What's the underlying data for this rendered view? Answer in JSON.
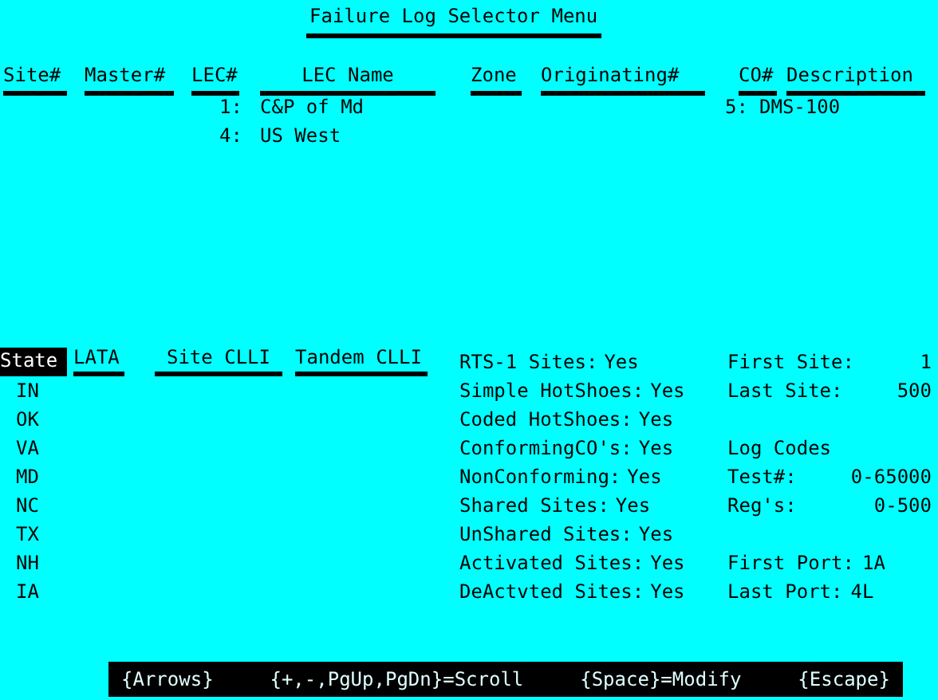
{
  "title": "Failure Log Selector Menu",
  "lec_table": {
    "columns": [
      "Site#",
      "Master#",
      "LEC#",
      "LEC Name",
      "Zone",
      "Originating#",
      "CO#",
      "Description"
    ],
    "lec_rows": [
      {
        "number": "1:",
        "name": "C&P of Md"
      },
      {
        "number": "4:",
        "name": "US West"
      }
    ],
    "co_rows": [
      {
        "number": "5:",
        "name": "DMS-100"
      }
    ]
  },
  "site_table": {
    "columns": [
      {
        "label": "State",
        "selected": true
      },
      {
        "label": "LATA",
        "selected": false
      },
      {
        "label": "Site CLLI",
        "selected": false
      },
      {
        "label": "Tandem CLLI",
        "selected": false
      }
    ],
    "states": [
      "IN",
      "OK",
      "VA",
      "MD",
      "NC",
      "TX",
      "NH",
      "IA"
    ]
  },
  "options": [
    {
      "label": "RTS-1 Sites:",
      "value": "Yes"
    },
    {
      "label": "Simple HotShoes:",
      "value": "Yes"
    },
    {
      "label": "Coded HotShoes:",
      "value": "Yes"
    },
    {
      "label": "ConformingCO's:",
      "value": "Yes"
    },
    {
      "label": "NonConforming:",
      "value": "Yes"
    },
    {
      "label": "Shared Sites:",
      "value": "Yes"
    },
    {
      "label": "UnShared Sites:",
      "value": "Yes"
    },
    {
      "label": "Activated Sites:",
      "value": "Yes"
    },
    {
      "label": "DeActvted Sites:",
      "value": "Yes"
    }
  ],
  "site_range": [
    {
      "label": "First Site:",
      "value": "1"
    },
    {
      "label": "Last Site:",
      "value": "500"
    }
  ],
  "log_codes": {
    "title": "Log Codes",
    "items": [
      {
        "label": "Test#:",
        "value": "0-65000"
      },
      {
        "label": "Reg's:",
        "value": "0-500"
      }
    ]
  },
  "ports": [
    {
      "label": "First Port:",
      "value": "1A"
    },
    {
      "label": "Last Port:",
      "value": "4L"
    }
  ],
  "footer": [
    "{Arrows}",
    "{+,-,PgUp,PgDn}=Scroll",
    "{Space}=Modify",
    "{Escape}"
  ]
}
